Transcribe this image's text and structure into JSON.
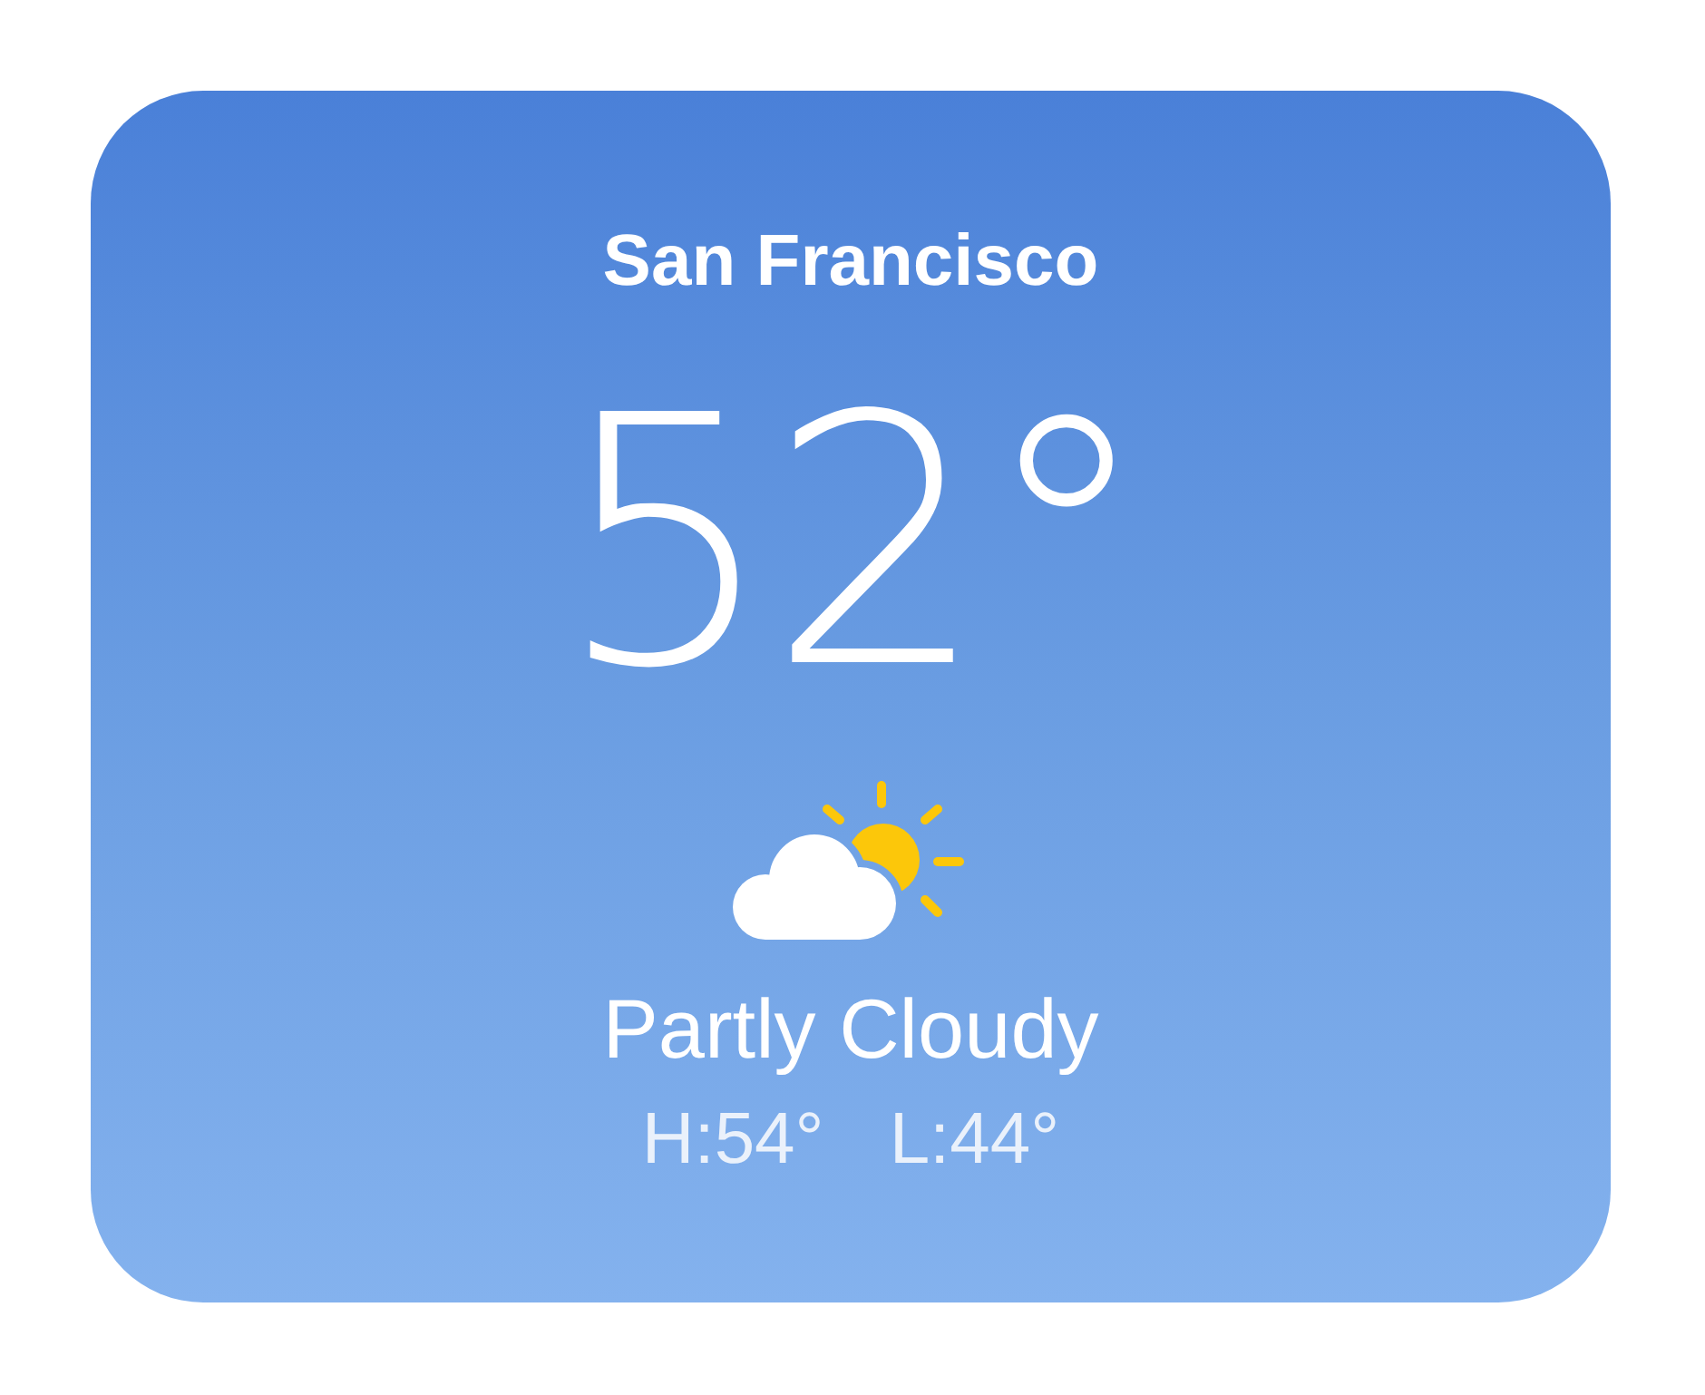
{
  "location": {
    "city": "San Francisco"
  },
  "current": {
    "temperature": "52°",
    "condition": "Partly Cloudy",
    "high": "H:54°",
    "low": "L:44°"
  }
}
